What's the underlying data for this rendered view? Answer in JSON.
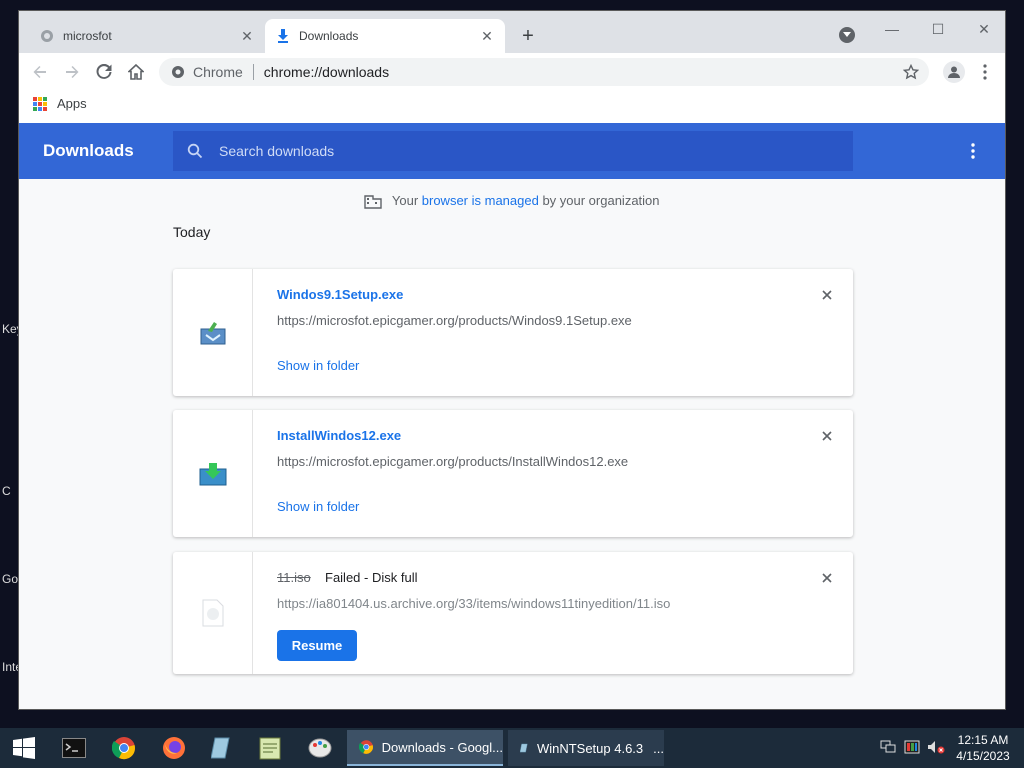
{
  "desktop": {
    "labels": [
      "Key",
      "C",
      "Go",
      "Inte"
    ]
  },
  "browser": {
    "tabs": [
      {
        "title": "microsfot",
        "active": false
      },
      {
        "title": "Downloads",
        "active": true
      }
    ],
    "window_controls": {
      "minimize": "—",
      "maximize": "☐",
      "close": "✕"
    },
    "omnibox": {
      "chip": "Chrome",
      "url": "chrome://downloads"
    },
    "bookmarks": {
      "apps_label": "Apps"
    }
  },
  "downloads_page": {
    "title": "Downloads",
    "search_placeholder": "Search downloads",
    "managed_notice": {
      "prefix": "Your ",
      "link": "browser is managed",
      "suffix": " by your organization"
    },
    "section_label": "Today",
    "items": [
      {
        "filename": "Windos9.1Setup.exe",
        "url": "https://microsfot.epicgamer.org/products/Windos9.1Setup.exe",
        "action": "Show in folder"
      },
      {
        "filename": "InstallWindos12.exe",
        "url": "https://microsfot.epicgamer.org/products/InstallWindos12.exe",
        "action": "Show in folder"
      },
      {
        "filename": "11.iso",
        "status": "Failed - Disk full",
        "url": "https://ia801404.us.archive.org/33/items/windows11tinyedition/11.iso",
        "action": "Resume"
      }
    ]
  },
  "taskbar": {
    "apps": [
      {
        "label": "Downloads - Googl...",
        "icon": "chrome-icon",
        "active": true
      },
      {
        "label": "WinNTSetup 4.6.3",
        "icon": "winntsetup-icon",
        "active": false,
        "more": "..."
      }
    ],
    "clock": {
      "time": "12:15 AM",
      "date": "4/15/2023"
    }
  },
  "colors": {
    "header_blue": "#3367d6",
    "link_blue": "#1a73e8",
    "taskbar": "#1c2b3a"
  }
}
